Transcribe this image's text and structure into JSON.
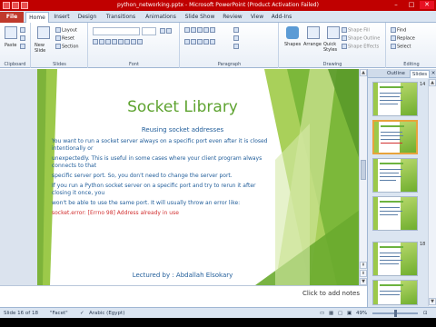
{
  "window": {
    "title": "python_networking.pptx - Microsoft PowerPoint (Product Activation Failed)",
    "controls": [
      "–",
      "□",
      "✕"
    ]
  },
  "tabs": [
    "File",
    "Home",
    "Insert",
    "Design",
    "Transitions",
    "Animations",
    "Slide Show",
    "Review",
    "View",
    "Add-Ins"
  ],
  "ribbon": {
    "clipboard": {
      "paste": "Paste",
      "label": "Clipboard"
    },
    "slides": {
      "new_slide": "New Slide",
      "layout": "Layout",
      "reset": "Reset",
      "section": "Section",
      "label": "Slides"
    },
    "font": {
      "label": "Font"
    },
    "paragraph": {
      "label": "Paragraph"
    },
    "drawing": {
      "shapes": "Shapes",
      "arrange": "Arrange",
      "quick_styles": "Quick Styles",
      "shape_fill": "Shape Fill",
      "shape_outline": "Shape Outline",
      "shape_effects": "Shape Effects",
      "label": "Drawing"
    },
    "editing": {
      "find": "Find",
      "replace": "Replace",
      "select": "Select",
      "label": "Editing"
    }
  },
  "slide": {
    "title": "Socket Library",
    "subtitle": "Reusing socket addresses",
    "body": [
      "You want to run a socket server always on a specific port even after it is closed intentionally or",
      "unexpectedly. This is useful in some cases where your client program always connects to that",
      "specific server port. So, you don't need to change the server port.",
      "If you run a Python socket server on a specific port and try to rerun it after closing it once, you",
      "won't be able to use the same port. It will usually throw an error like:"
    ],
    "error_line": "socket.error: [Errno 98] Address already in use",
    "footer": "Lectured by : Abdallah Elsokary"
  },
  "notes": {
    "placeholder": "Click to add notes"
  },
  "panel": {
    "tabs": [
      "Outline",
      "Slides"
    ],
    "thumbnails": [
      {
        "number": "14",
        "selected": false
      },
      {
        "number": "",
        "selected": true
      },
      {
        "number": "",
        "selected": false
      },
      {
        "number": "",
        "selected": false
      },
      {
        "number": "18",
        "selected": false
      }
    ]
  },
  "status": {
    "slide_info": "Slide 16 of 18",
    "theme": "\"Facet\"",
    "language": "Arabic (Egypt)",
    "zoom": "49%"
  },
  "colors": {
    "accent_red": "#c00000",
    "title_green": "#5ea330",
    "body_blue": "#1f5c99",
    "error_red": "#d12f2f"
  }
}
